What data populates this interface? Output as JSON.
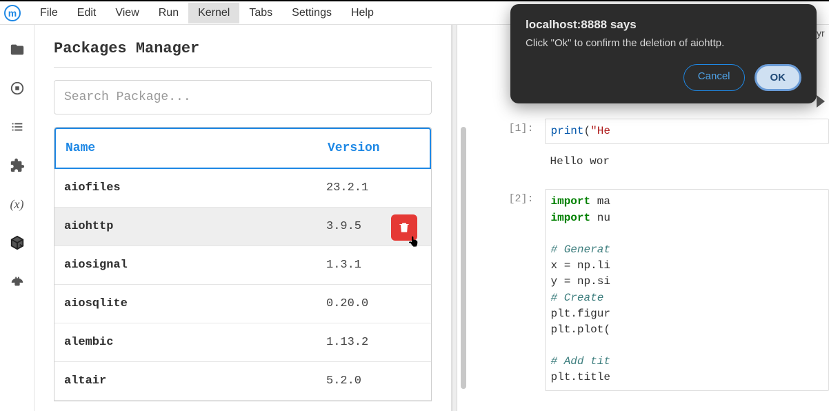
{
  "menu": {
    "items": [
      "File",
      "Edit",
      "View",
      "Run",
      "Kernel",
      "Tabs",
      "Settings",
      "Help"
    ],
    "active_index": 4
  },
  "logo_letter": "m",
  "sidebar": {
    "icons": [
      "folder-icon",
      "running-icon",
      "list-icon",
      "extension-icon",
      "variable-icon",
      "package-icon",
      "build-icon"
    ]
  },
  "panel": {
    "title": "Packages Manager",
    "search_placeholder": "Search Package...",
    "columns": {
      "name": "Name",
      "version": "Version"
    },
    "rows": [
      {
        "name": "aiofiles",
        "version": "23.2.1",
        "selected": false
      },
      {
        "name": "aiohttp",
        "version": "3.9.5",
        "selected": true
      },
      {
        "name": "aiosignal",
        "version": "1.3.1",
        "selected": false
      },
      {
        "name": "aiosqlite",
        "version": "0.20.0",
        "selected": false
      },
      {
        "name": "alembic",
        "version": "1.13.2",
        "selected": false
      },
      {
        "name": "altair",
        "version": "5.2.0",
        "selected": false
      }
    ]
  },
  "notebook": {
    "cells": [
      {
        "prompt": "[1]:",
        "code_html": "<span class='fn'>print</span><span class='paren'>(</span><span class='str'>\"He</span>",
        "output": "Hello wor"
      },
      {
        "prompt": "[2]:",
        "code_html": "<span class='kw'>import</span> ma\n<span class='kw'>import</span> nu\n\n<span class='cm'># Generat</span>\nx = np.li\ny = np.si\n<span class='cm'># Create </span>\nplt.figur\nplt.plot(\n\n<span class='cm'># Add tit</span>\nplt.title"
      }
    ]
  },
  "dialog": {
    "title": "localhost:8888 says",
    "message": "Click \"Ok\" to confirm the deletion of aiohttp.",
    "cancel": "Cancel",
    "ok": "OK"
  },
  "truncated_label": "yr"
}
